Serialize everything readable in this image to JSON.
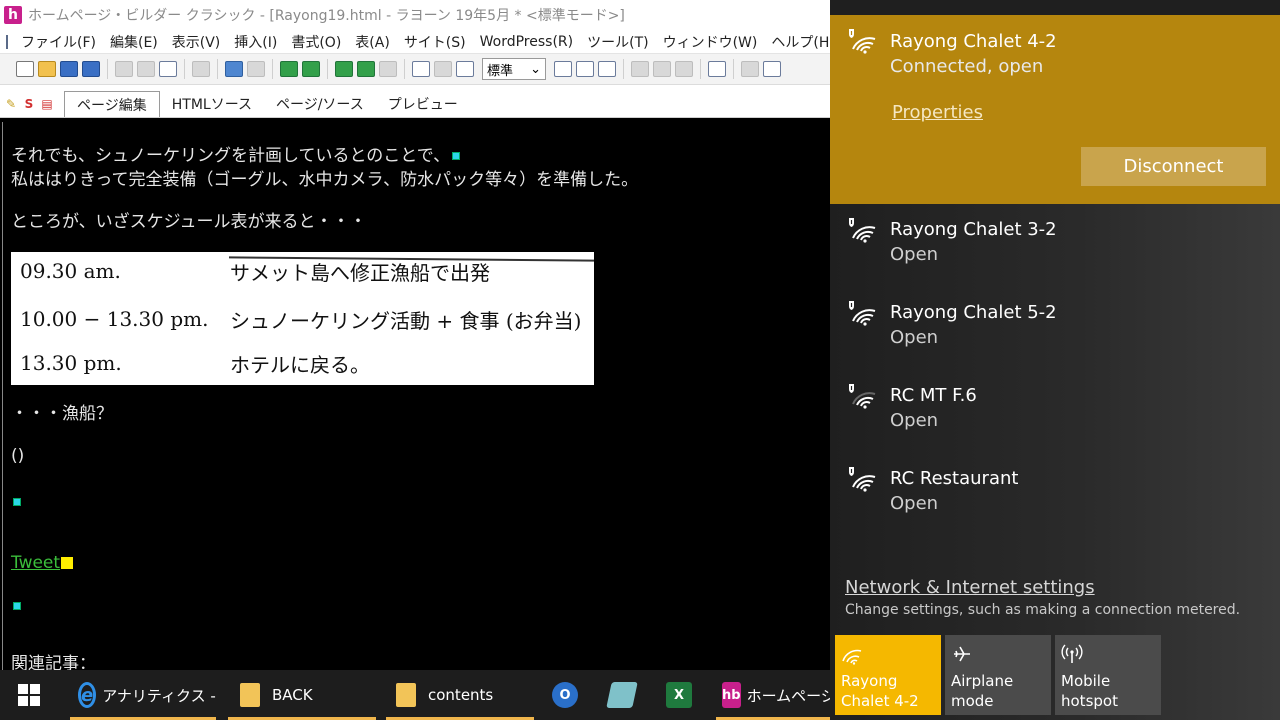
{
  "editor": {
    "title": "ホームページ・ビルダー クラシック - [Rayong19.html - ラヨーン 19年5月 * <標準モード>]",
    "app_icon": "h",
    "menu": [
      "ファイル(F)",
      "編集(E)",
      "表示(V)",
      "挿入(I)",
      "書式(O)",
      "表(A)",
      "サイト(S)",
      "WordPress(R)",
      "ツール(T)",
      "ウィンドウ(W)",
      "ヘルプ(H)"
    ],
    "style_select": "標準",
    "tabs": [
      "ページ編集",
      "HTMLソース",
      "ページ/ソース",
      "プレビュー"
    ],
    "active_tab": "ページ編集",
    "content": {
      "line1": "それでも、シュノーケリングを計画しているとのことで、",
      "line2": "私ははりきって完全装備（ゴーグル、水中カメラ、防水パック等々）を準備した。",
      "line3": "ところが、いざスケジュール表が来ると・・・",
      "schedule": [
        {
          "time": "09.30 am.",
          "text": "サメット島へ修正漁船で出発"
        },
        {
          "time": "10.00 − 13.30 pm.",
          "text": "シュノーケリング活動 + 食事 (お弁当)"
        },
        {
          "time": "13.30 pm.",
          "text": "ホテルに戻る。"
        }
      ],
      "line4": "・・・漁船？",
      "line5": "()",
      "tweet": "Tweet",
      "line6": "関連記事："
    }
  },
  "flyout": {
    "connected": {
      "name": "Rayong Chalet 4-2",
      "status": "Connected, open",
      "properties": "Properties",
      "disconnect": "Disconnect"
    },
    "networks": [
      {
        "name": "Rayong Chalet 3-2",
        "status": "Open"
      },
      {
        "name": "Rayong Chalet 5-2",
        "status": "Open"
      },
      {
        "name": "RC MT F.6",
        "status": "Open"
      },
      {
        "name": "RC Restaurant",
        "status": "Open"
      }
    ],
    "settings_link": "Network & Internet settings",
    "settings_desc": "Change settings, such as making a connection metered.",
    "quick_actions": [
      {
        "label": "Rayong Chalet 4-2",
        "icon": "wifi-icon",
        "active": true
      },
      {
        "label": "Airplane mode",
        "icon": "airplane-icon",
        "active": false
      },
      {
        "label": "Mobile hotspot",
        "icon": "hotspot-icon",
        "active": false
      }
    ],
    "accent": "#b5860e",
    "quick_accent": "#f5b800"
  },
  "taskbar": {
    "items": [
      {
        "label": "アナリティクス - ...",
        "icon": "ie-icon"
      },
      {
        "label": "BACK",
        "icon": "folder-icon"
      },
      {
        "label": "contents",
        "icon": "folder-icon"
      },
      {
        "label": "",
        "icon": "outlook-icon"
      },
      {
        "label": "",
        "icon": "notepad-icon"
      },
      {
        "label": "",
        "icon": "excel-icon"
      },
      {
        "label": "ホームページ",
        "icon": "hpb-icon"
      }
    ]
  }
}
